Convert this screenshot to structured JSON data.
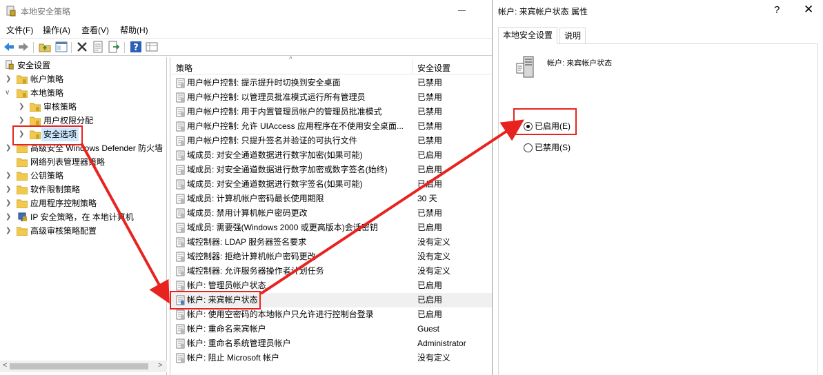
{
  "main_window": {
    "title": "本地安全策略",
    "menu": [
      "文件(F)",
      "操作(A)",
      "查看(V)",
      "帮助(H)"
    ],
    "toolbar_icons": [
      "back-icon",
      "forward-icon",
      "up-folder-icon",
      "show-hide-tree-icon",
      "delete-icon",
      "properties-icon",
      "export-icon",
      "help-icon",
      "view-icon"
    ]
  },
  "tree": {
    "items": [
      {
        "label": "安全设置",
        "icon": "security-settings-icon"
      },
      {
        "label": "帐户策略",
        "icon": "folder-icon"
      },
      {
        "label": "本地策略",
        "icon": "folder-icon"
      },
      {
        "label": "审核策略",
        "icon": "folder-icon"
      },
      {
        "label": "用户权限分配",
        "icon": "folder-icon"
      },
      {
        "label": "安全选项",
        "icon": "folder-icon"
      },
      {
        "label": "高级安全 Windows Defender 防火墙",
        "icon": "folder-icon"
      },
      {
        "label": "网络列表管理器策略",
        "icon": "folder-icon"
      },
      {
        "label": "公钥策略",
        "icon": "folder-icon"
      },
      {
        "label": "软件限制策略",
        "icon": "folder-icon"
      },
      {
        "label": "应用程序控制策略",
        "icon": "folder-icon"
      },
      {
        "label": "IP 安全策略，在 本地计算机",
        "icon": "ip-security-icon"
      },
      {
        "label": "高级审核策略配置",
        "icon": "folder-icon"
      }
    ],
    "scroll_left": "<",
    "scroll_right": ">"
  },
  "list": {
    "headers": {
      "policy": "策略",
      "setting": "安全设置",
      "sort": "^"
    },
    "rows": [
      {
        "name": "用户帐户控制: 提示提升时切换到安全桌面",
        "value": "已禁用"
      },
      {
        "name": "用户帐户控制: 以管理员批准模式运行所有管理员",
        "value": "已禁用"
      },
      {
        "name": "用户帐户控制: 用于内置管理员帐户的管理员批准模式",
        "value": "已禁用"
      },
      {
        "name": "用户帐户控制: 允许 UIAccess 应用程序在不使用安全桌面...",
        "value": "已禁用"
      },
      {
        "name": "用户帐户控制: 只提升签名并验证的可执行文件",
        "value": "已禁用"
      },
      {
        "name": "域成员: 对安全通道数据进行数字加密(如果可能)",
        "value": "已启用"
      },
      {
        "name": "域成员: 对安全通道数据进行数字加密或数字签名(始终)",
        "value": "已启用"
      },
      {
        "name": "域成员: 对安全通道数据进行数字签名(如果可能)",
        "value": "已启用"
      },
      {
        "name": "域成员: 计算机帐户密码最长使用期限",
        "value": "30 天"
      },
      {
        "name": "域成员: 禁用计算机帐户密码更改",
        "value": "已禁用"
      },
      {
        "name": "域成员: 需要强(Windows 2000 或更高版本)会话密钥",
        "value": "已启用"
      },
      {
        "name": "域控制器: LDAP 服务器签名要求",
        "value": "没有定义"
      },
      {
        "name": "域控制器: 拒绝计算机帐户密码更改",
        "value": "没有定义"
      },
      {
        "name": "域控制器: 允许服务器操作者计划任务",
        "value": "没有定义"
      },
      {
        "name": "帐户: 管理员帐户状态",
        "value": "已启用"
      },
      {
        "name": "帐户: 来宾帐户状态",
        "value": "已启用"
      },
      {
        "name": "帐户: 使用空密码的本地帐户只允许进行控制台登录",
        "value": "已启用"
      },
      {
        "name": "帐户: 重命名来宾帐户",
        "value": "Guest"
      },
      {
        "name": "帐户: 重命名系统管理员帐户",
        "value": "Administrator"
      },
      {
        "name": "帐户: 阻止 Microsoft 帐户",
        "value": "没有定义"
      }
    ]
  },
  "dialog": {
    "title": "帐户: 来宾帐户状态 属性",
    "help": "?",
    "close": "✕",
    "tabs": [
      "本地安全设置",
      "说明"
    ],
    "heading": "帐户: 来宾帐户状态",
    "enabled_label": "已启用(E)",
    "disabled_label": "已禁用(S)",
    "selected": "enabled"
  },
  "annotation_color": "#e8231f"
}
